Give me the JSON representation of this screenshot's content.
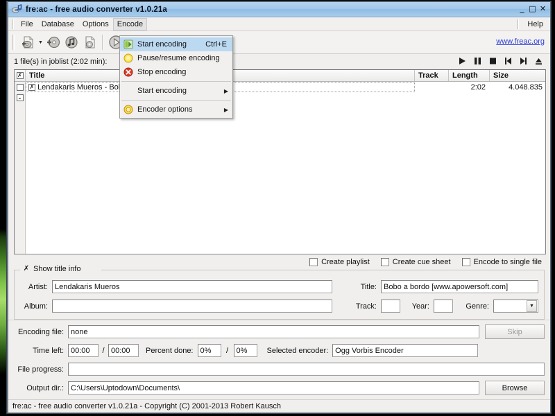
{
  "window": {
    "title": "fre:ac - free audio converter v1.0.21a",
    "icon": "app-icon",
    "buttons": {
      "minimize": "_",
      "maximize": "□",
      "close": "✕"
    }
  },
  "menubar": {
    "items": [
      {
        "label": "File",
        "active": false
      },
      {
        "label": "Database",
        "active": false
      },
      {
        "label": "Options",
        "active": false
      },
      {
        "label": "Encode",
        "active": true
      }
    ],
    "help": "Help"
  },
  "dropdown": {
    "open_menu": "Encode",
    "items": [
      {
        "label": "Start encoding",
        "accel": "Ctrl+E",
        "icon": "green-play-icon",
        "selected": true,
        "submenu": false
      },
      {
        "label": "Pause/resume encoding",
        "accel": "",
        "icon": "yellow-pause-icon",
        "selected": false,
        "submenu": false
      },
      {
        "label": "Stop encoding",
        "accel": "",
        "icon": "red-stop-icon",
        "selected": false,
        "submenu": false
      },
      {
        "separator": true
      },
      {
        "label": "Start encoding",
        "accel": "",
        "icon": "",
        "selected": false,
        "submenu": true
      },
      {
        "separator": true
      },
      {
        "label": "Encoder options",
        "accel": "",
        "icon": "yellow-gear-icon",
        "selected": false,
        "submenu": true
      }
    ]
  },
  "toolbar": {
    "buttons": [
      {
        "name": "add-audio-file-button",
        "icon": "add-file-icon"
      },
      {
        "name": "add-file-dropdown-button",
        "icon": "caret-down-icon"
      },
      {
        "name": "add-audio-cd-button",
        "icon": "add-cd-icon"
      },
      {
        "name": "add-track-button",
        "icon": "music-note-icon"
      },
      {
        "name": "remove-track-button",
        "icon": "remove-file-icon"
      },
      {
        "name": "start-encoding-button",
        "icon": "play-icon"
      },
      {
        "name": "start-encoding-dropdown-button",
        "icon": "caret-down-icon"
      },
      {
        "name": "pause-encoding-button",
        "icon": "pause-icon"
      },
      {
        "name": "stop-encoding-button",
        "icon": "stop-x-icon"
      }
    ],
    "website_link": "www.freac.org"
  },
  "joblist": {
    "count_text": "1 file(s) in joblist (2:02 min):",
    "media_controls": [
      "play-icon",
      "pause-icon",
      "stop-icon",
      "previous-icon",
      "next-icon",
      "eject-icon"
    ],
    "columns": [
      "Title",
      "Track",
      "Length",
      "Size"
    ],
    "rows": [
      {
        "checked": false,
        "title": "Lendakaris Mueros - Bob",
        "track": "",
        "length": "2:02",
        "size": "4.048.835"
      }
    ]
  },
  "options": {
    "create_playlist": {
      "label": "Create playlist",
      "checked": false
    },
    "create_cue_sheet": {
      "label": "Create cue sheet",
      "checked": false
    },
    "encode_single_file": {
      "label": "Encode to single file",
      "checked": false
    }
  },
  "title_info": {
    "legend": "Show title info",
    "legend_checked": true,
    "artist": {
      "label": "Artist:",
      "value": "Lendakaris Mueros"
    },
    "title": {
      "label": "Title:",
      "value": "Bobo a bordo [www.apowersoft.com]"
    },
    "album": {
      "label": "Album:",
      "value": ""
    },
    "track": {
      "label": "Track:",
      "value": ""
    },
    "year": {
      "label": "Year:",
      "value": ""
    },
    "genre": {
      "label": "Genre:",
      "value": ""
    }
  },
  "encoding": {
    "file_label": "Encoding file:",
    "file_value": "none",
    "skip_button": "Skip",
    "time_left_label": "Time left:",
    "time_left_current": "00:00",
    "time_left_sep": "/",
    "time_left_total": "00:00",
    "percent_label": "Percent done:",
    "percent_current": "0%",
    "percent_sep": "/",
    "percent_total": "0%",
    "encoder_label": "Selected encoder:",
    "encoder_value": "Ogg Vorbis Encoder",
    "file_progress_label": "File progress:",
    "file_progress_value": "",
    "output_dir_label": "Output dir.:",
    "output_dir_value": "C:\\Users\\Uptodown\\Documents\\",
    "browse_button": "Browse"
  },
  "statusbar": {
    "text": "fre:ac - free audio converter v1.0.21a - Copyright (C) 2001-2013 Robert Kausch"
  },
  "colors": {
    "titlebar": "#a3c9ea",
    "menu_highlight": "#bcd9f2",
    "link": "#2b3ed6",
    "window_bg": "#f0efee"
  }
}
